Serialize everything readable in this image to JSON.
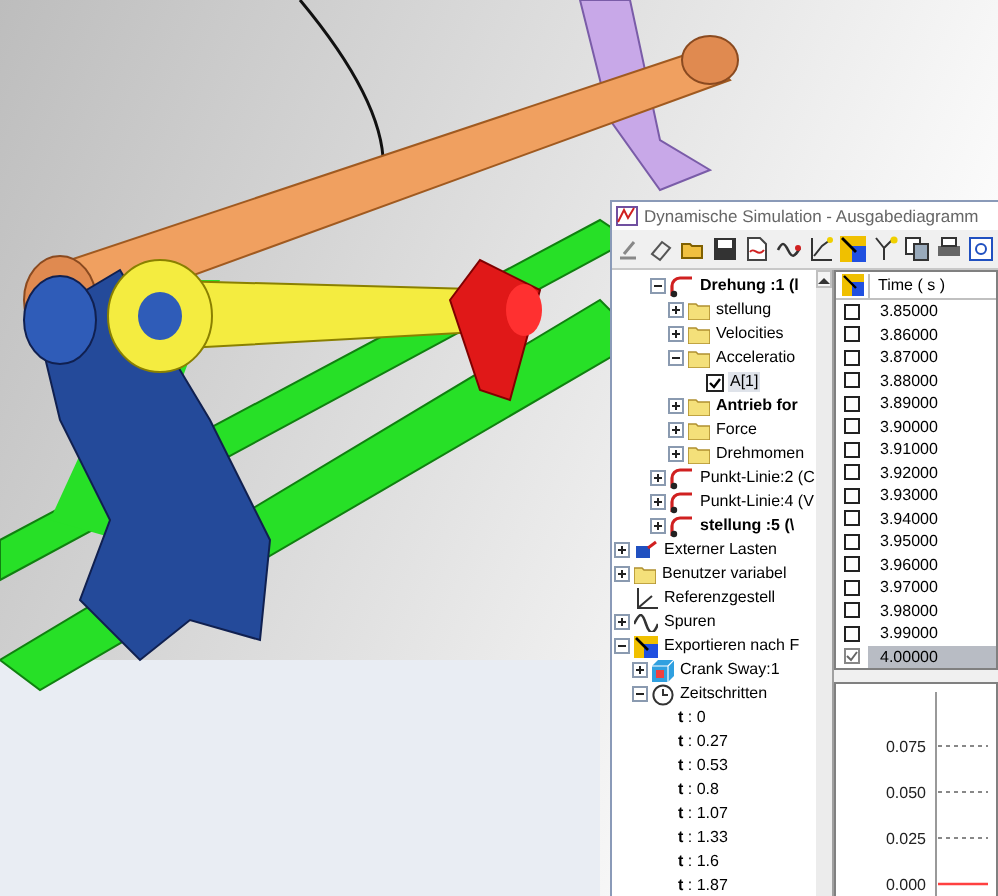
{
  "window": {
    "title": "Dynamische Simulation - Ausgabediagramm"
  },
  "tree": {
    "continued_items": [
      {
        "label": "Drehung :1 (l",
        "kind": "joint",
        "bold": true,
        "expanded": true,
        "children": [
          {
            "label": "stellung",
            "kind": "folder",
            "bold": false,
            "expanded": false
          },
          {
            "label": "Velocities",
            "kind": "folder",
            "bold": false,
            "expanded": false
          },
          {
            "label": "Acceleratio",
            "kind": "folder",
            "bold": false,
            "expanded": true,
            "children": [
              {
                "label": "A[1]",
                "kind": "check",
                "bold": false,
                "checked": true
              }
            ]
          },
          {
            "label": "Antrieb for",
            "kind": "folder",
            "bold": true,
            "expanded": false
          },
          {
            "label": "Force",
            "kind": "folder",
            "bold": false,
            "expanded": false
          },
          {
            "label": "Drehmomen",
            "kind": "folder",
            "bold": false,
            "expanded": false
          }
        ]
      },
      {
        "label": "Punkt-Linie:2 (C",
        "kind": "joint",
        "bold": false,
        "expanded": false
      },
      {
        "label": "Punkt-Linie:4 (V",
        "kind": "joint",
        "bold": false,
        "expanded": false
      },
      {
        "label": "stellung :5 (\\",
        "kind": "joint",
        "bold": true,
        "expanded": false
      }
    ],
    "items": [
      {
        "label": "Externer Lasten",
        "kind": "load",
        "bold": false,
        "expanded": false
      },
      {
        "label": "Benutzer variabel",
        "kind": "folder",
        "bold": false,
        "expanded": false
      },
      {
        "label": "Referenzgestell",
        "kind": "frame",
        "bold": false
      },
      {
        "label": "Spuren",
        "kind": "trace",
        "bold": false,
        "expanded": false
      },
      {
        "label": "Exportieren nach F",
        "kind": "export",
        "bold": false,
        "expanded": true,
        "children": [
          {
            "label": "Crank Sway:1",
            "kind": "body",
            "bold": false,
            "expanded": false
          },
          {
            "label": "Zeitschritten",
            "kind": "clock",
            "bold": false,
            "expanded": true,
            "children": [
              {
                "label": "**t** : 0",
                "kind": "time",
                "bold": false
              },
              {
                "label": "**t** : 0.27",
                "kind": "time",
                "bold": false
              },
              {
                "label": "**t** : 0.53",
                "kind": "time",
                "bold": false
              },
              {
                "label": "**t** : 0.8",
                "kind": "time",
                "bold": false
              },
              {
                "label": "**t** : 1.07",
                "kind": "time",
                "bold": false
              },
              {
                "label": "**t** : 1.33",
                "kind": "time",
                "bold": false
              },
              {
                "label": "**t** : 1.6",
                "kind": "time",
                "bold": false
              },
              {
                "label": "**t** : 1.87",
                "kind": "time",
                "bold": false
              }
            ]
          }
        ]
      }
    ]
  },
  "table": {
    "columns": [
      "Time ( s )"
    ],
    "rows": [
      {
        "time": "3.85000",
        "checked": false,
        "selected": false
      },
      {
        "time": "3.86000",
        "checked": false,
        "selected": false
      },
      {
        "time": "3.87000",
        "checked": false,
        "selected": false
      },
      {
        "time": "3.88000",
        "checked": false,
        "selected": false
      },
      {
        "time": "3.89000",
        "checked": false,
        "selected": false
      },
      {
        "time": "3.90000",
        "checked": false,
        "selected": false
      },
      {
        "time": "3.91000",
        "checked": false,
        "selected": false
      },
      {
        "time": "3.92000",
        "checked": false,
        "selected": false
      },
      {
        "time": "3.93000",
        "checked": false,
        "selected": false
      },
      {
        "time": "3.94000",
        "checked": false,
        "selected": false
      },
      {
        "time": "3.95000",
        "checked": false,
        "selected": false
      },
      {
        "time": "3.96000",
        "checked": false,
        "selected": false
      },
      {
        "time": "3.97000",
        "checked": false,
        "selected": false
      },
      {
        "time": "3.98000",
        "checked": false,
        "selected": false
      },
      {
        "time": "3.99000",
        "checked": false,
        "selected": false
      },
      {
        "time": "4.00000",
        "checked": true,
        "selected": true
      }
    ]
  },
  "chart": {
    "y_tick_labels": [
      "0.075",
      "0.050",
      "0.025",
      "0.000"
    ]
  }
}
